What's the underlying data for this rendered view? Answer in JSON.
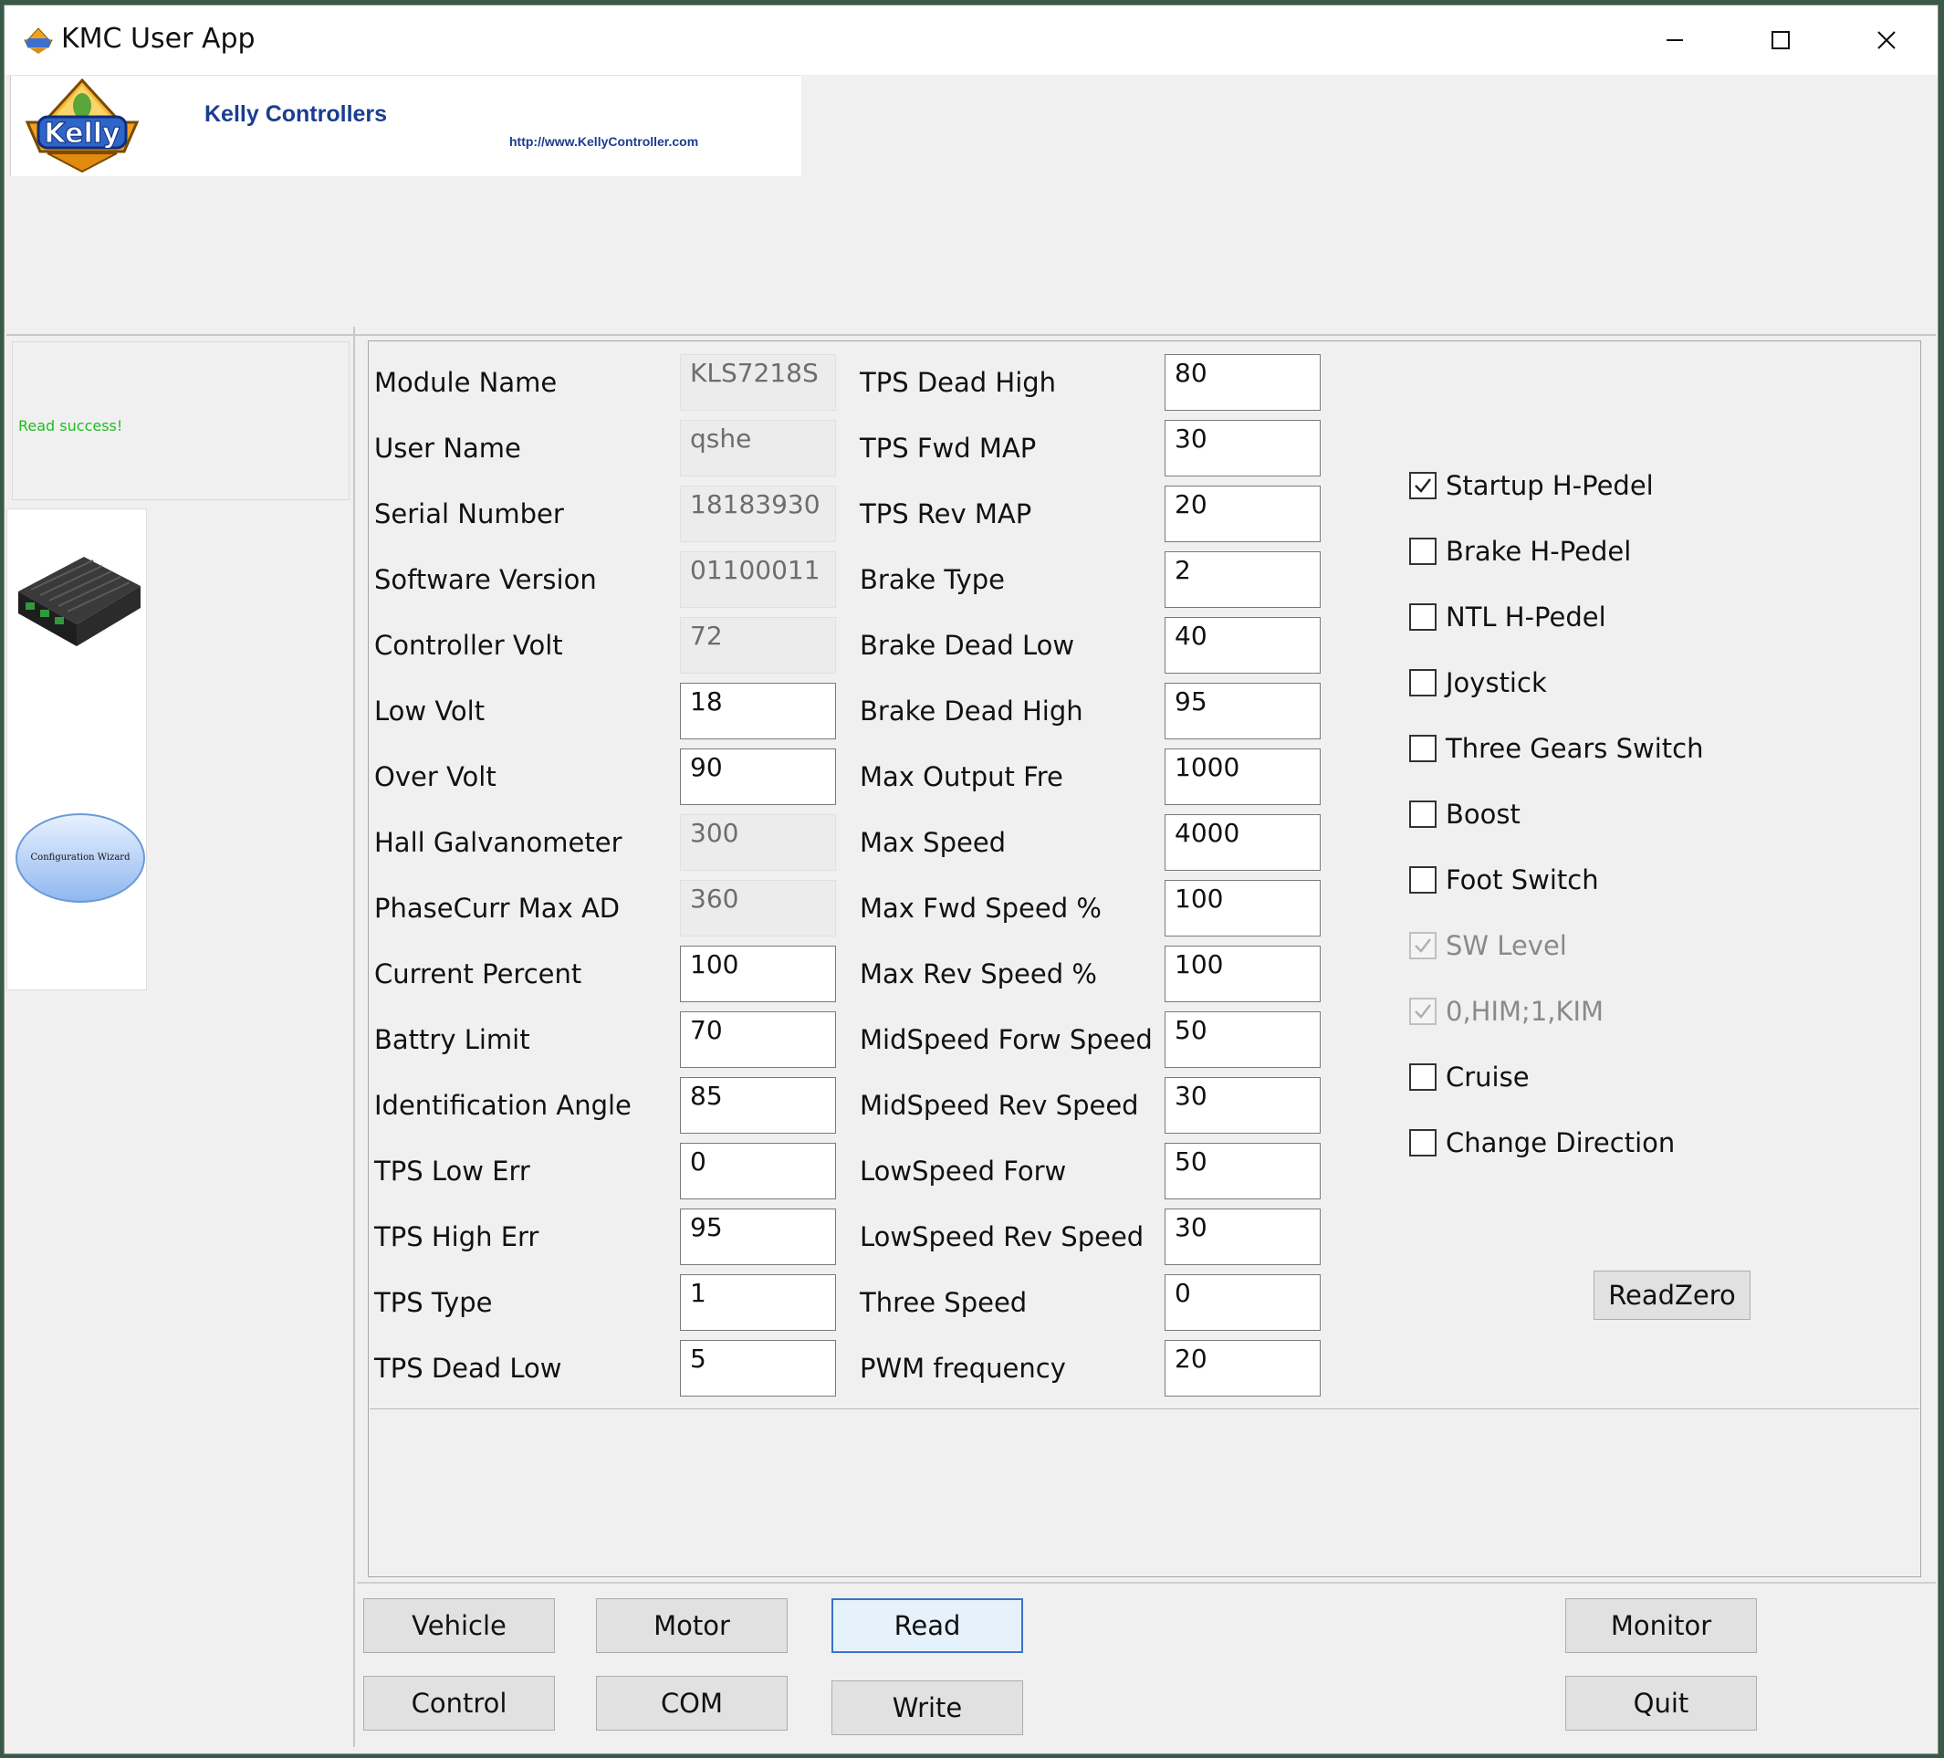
{
  "window": {
    "title": "KMC User App",
    "controls": {
      "minimize_icon": "minimize-icon",
      "maximize_icon": "maximize-icon",
      "close_icon": "close-icon"
    }
  },
  "banner": {
    "brand": "Kelly Controllers",
    "url": "http://www.KellyController.com",
    "logo_text": "Kelly"
  },
  "status": {
    "message": "Read success!"
  },
  "side_nav": {
    "wizard_label": "Configuration Wizard"
  },
  "params_col1": [
    {
      "label": "Module Name",
      "value": "KLS7218S",
      "readonly": true
    },
    {
      "label": "User Name",
      "value": "qshe",
      "readonly": true
    },
    {
      "label": "Serial Number",
      "value": "18183930",
      "readonly": true
    },
    {
      "label": "Software Version",
      "value": "01100011",
      "readonly": true
    },
    {
      "label": "Controller Volt",
      "value": "72",
      "readonly": true
    },
    {
      "label": "Low Volt",
      "value": "18",
      "readonly": false
    },
    {
      "label": "Over Volt",
      "value": "90",
      "readonly": false
    },
    {
      "label": "Hall Galvanometer",
      "value": "300",
      "readonly": true
    },
    {
      "label": "PhaseCurr Max AD",
      "value": "360",
      "readonly": true
    },
    {
      "label": "Current Percent",
      "value": "100",
      "readonly": false
    },
    {
      "label": "Battry Limit",
      "value": "70",
      "readonly": false
    },
    {
      "label": "Identification Angle",
      "value": "85",
      "readonly": false
    },
    {
      "label": "TPS Low Err",
      "value": "0",
      "readonly": false
    },
    {
      "label": "TPS High Err",
      "value": "95",
      "readonly": false
    },
    {
      "label": "TPS Type",
      "value": "1",
      "readonly": false
    },
    {
      "label": "TPS Dead Low",
      "value": "5",
      "readonly": false
    }
  ],
  "params_col2": [
    {
      "label": "TPS Dead High",
      "value": "80"
    },
    {
      "label": "TPS Fwd MAP",
      "value": "30"
    },
    {
      "label": "TPS Rev MAP",
      "value": "20"
    },
    {
      "label": "Brake Type",
      "value": "2"
    },
    {
      "label": "Brake Dead Low",
      "value": "40"
    },
    {
      "label": "Brake Dead High",
      "value": "95"
    },
    {
      "label": "Max Output Fre",
      "value": "1000"
    },
    {
      "label": "Max Speed",
      "value": "4000"
    },
    {
      "label": "Max Fwd Speed %",
      "value": "100"
    },
    {
      "label": "Max Rev Speed %",
      "value": "100"
    },
    {
      "label": "MidSpeed Forw Speed",
      "value": "50"
    },
    {
      "label": "MidSpeed Rev Speed",
      "value": "30"
    },
    {
      "label": "LowSpeed Forw",
      "value": "50"
    },
    {
      "label": "LowSpeed Rev Speed",
      "value": "30"
    },
    {
      "label": "Three Speed",
      "value": "0"
    },
    {
      "label": "PWM frequency",
      "value": "20"
    }
  ],
  "options": [
    {
      "label": "Startup H-Pedel",
      "checked": true,
      "disabled": false
    },
    {
      "label": "Brake H-Pedel",
      "checked": false,
      "disabled": false
    },
    {
      "label": "NTL H-Pedel",
      "checked": false,
      "disabled": false
    },
    {
      "label": "Joystick",
      "checked": false,
      "disabled": false
    },
    {
      "label": "Three Gears Switch",
      "checked": false,
      "disabled": false
    },
    {
      "label": "Boost",
      "checked": false,
      "disabled": false
    },
    {
      "label": "Foot Switch",
      "checked": false,
      "disabled": false
    },
    {
      "label": "SW Level",
      "checked": true,
      "disabled": true
    },
    {
      "label": "0,HIM;1,KIM",
      "checked": true,
      "disabled": true
    },
    {
      "label": "Cruise",
      "checked": false,
      "disabled": false
    },
    {
      "label": "Change Direction",
      "checked": false,
      "disabled": false
    }
  ],
  "buttons": {
    "readzero": "ReadZero",
    "vehicle": "Vehicle",
    "motor": "Motor",
    "read": "Read",
    "monitor": "Monitor",
    "control": "Control",
    "com": "COM",
    "write": "Write",
    "quit": "Quit"
  },
  "colors": {
    "status_text": "#22bb22",
    "brand_text": "#1a3d8f",
    "window_bg": "#f0f0f0",
    "default_button_border": "#3b73c9"
  }
}
